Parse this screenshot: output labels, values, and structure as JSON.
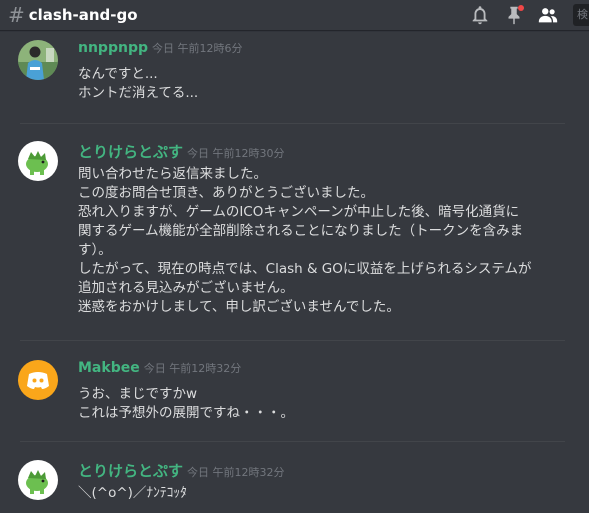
{
  "channel": {
    "hash": "#",
    "name": "clash-and-go"
  },
  "header_icons": [
    "bell-icon",
    "pin-icon",
    "members-icon"
  ],
  "search": {
    "placeholder": "検"
  },
  "messages": [
    {
      "author": "nnppnpp",
      "timestamp": "今日 午前12時6分",
      "author_color": "#43b581",
      "lines": [
        "なんですと...",
        "ホントだ消えてる..."
      ]
    },
    {
      "author": "とりけらとぷす",
      "timestamp": "今日 午前12時30分",
      "author_color": "#43b581",
      "lines": [
        "問い合わせたら返信来ました。",
        "この度お問合せ頂き、ありがとうございました。",
        "恐れ入りますが、ゲームのICOキャンペーンが中止した後、暗号化通貨に",
        "関するゲーム機能が全部削除されることになりました（トークンを含みま",
        "す）。",
        "したがって、現在の時点では、Clash & GOに収益を上げられるシステムが",
        "追加される見込みがございません。",
        "迷惑をおかけしまして、申し訳ございませんでした。"
      ]
    },
    {
      "author": "Makbee",
      "timestamp": "今日 午前12時32分",
      "author_color": "#43b581",
      "lines": [
        "うお、まじですかw",
        "これは予想外の展開ですね・・・。"
      ]
    },
    {
      "author": "とりけらとぷす",
      "timestamp": "今日 午前12時32分",
      "author_color": "#43b581",
      "lines": [
        "＼(^o^)／ﾅﾝﾃｺｯﾀ"
      ]
    }
  ],
  "colors": {
    "background": "#36393f",
    "author": "#43b581",
    "timestamp": "#72767d",
    "text": "#dcddde",
    "discord_avatar_bg": "#faa61a",
    "notification_dot": "#f04747"
  }
}
